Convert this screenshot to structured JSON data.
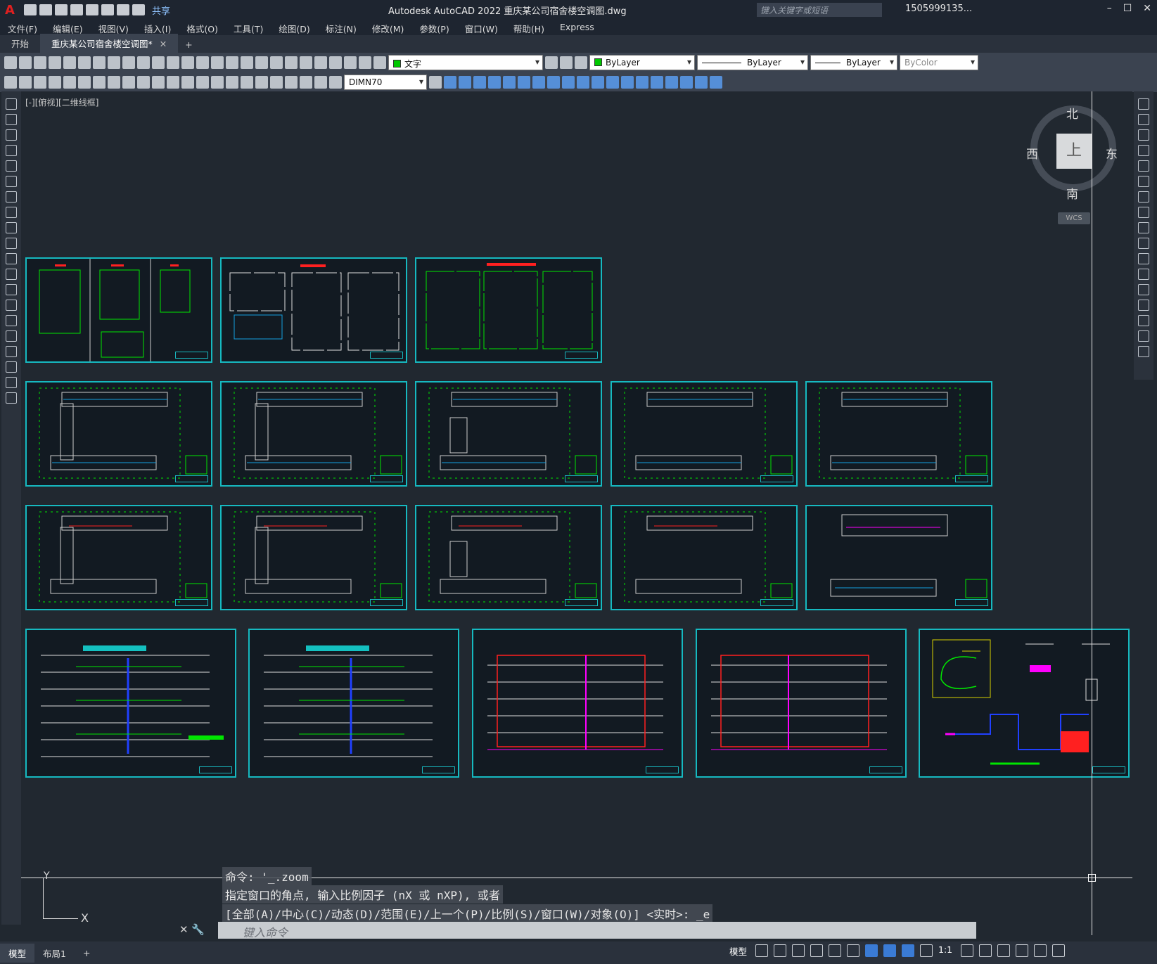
{
  "app": {
    "title": "Autodesk AutoCAD 2022    重庆某公司宿舍楼空调图.dwg",
    "logo": "A",
    "share_label": "共享"
  },
  "search": {
    "placeholder": "键入关键字或短语"
  },
  "user": {
    "name": "1505999135..."
  },
  "menu": [
    "文件(F)",
    "编辑(E)",
    "视图(V)",
    "插入(I)",
    "格式(O)",
    "工具(T)",
    "绘图(D)",
    "标注(N)",
    "修改(M)",
    "参数(P)",
    "窗口(W)",
    "帮助(H)",
    "Express"
  ],
  "tabs": {
    "start": "开始",
    "active": "重庆某公司宿舍楼空调图*"
  },
  "properties": {
    "layer": "文字",
    "color": "ByLayer",
    "linetype": "ByLayer",
    "lineweight": "ByLayer",
    "plotstyle": "ByColor",
    "dimstyle": "DIMN70"
  },
  "viewport": {
    "label": "[-][俯视][二维线框]"
  },
  "viewcube": {
    "north": "北",
    "south": "南",
    "east": "东",
    "west": "西",
    "top": "上",
    "wcs": "WCS"
  },
  "ucs": {
    "x": "X",
    "y": "Y"
  },
  "command": {
    "history": [
      "命令: '_.zoom",
      "指定窗口的角点, 输入比例因子 (nX 或 nXP), 或者",
      "[全部(A)/中心(C)/动态(D)/范围(E)/上一个(P)/比例(S)/窗口(W)/对象(O)] <实时>: _e"
    ],
    "placeholder": "键入命令"
  },
  "layouts": {
    "model": "模型",
    "layout1": "布局1",
    "add": "+"
  },
  "status": {
    "mode": "模型",
    "scale": "1:1"
  },
  "colors": {
    "sheet_border": "#16b9c0",
    "drawing_green": "#00e600",
    "drawing_red": "#ff2020",
    "canvas": "#212830"
  },
  "sheets": [
    {
      "id": "s01",
      "kind": "tables"
    },
    {
      "id": "s02",
      "kind": "notes"
    },
    {
      "id": "s03",
      "kind": "notes"
    },
    {
      "id": "s04",
      "kind": "plan"
    },
    {
      "id": "s05",
      "kind": "plan"
    },
    {
      "id": "s06",
      "kind": "plan"
    },
    {
      "id": "s07",
      "kind": "plan"
    },
    {
      "id": "s08",
      "kind": "plan"
    },
    {
      "id": "s09",
      "kind": "plan"
    },
    {
      "id": "s10",
      "kind": "plan"
    },
    {
      "id": "s11",
      "kind": "plan"
    },
    {
      "id": "s12",
      "kind": "plan"
    },
    {
      "id": "s13",
      "kind": "plan"
    },
    {
      "id": "s14",
      "kind": "riser"
    },
    {
      "id": "s15",
      "kind": "riser"
    },
    {
      "id": "s16",
      "kind": "system"
    },
    {
      "id": "s17",
      "kind": "system"
    },
    {
      "id": "s18",
      "kind": "detail"
    }
  ]
}
